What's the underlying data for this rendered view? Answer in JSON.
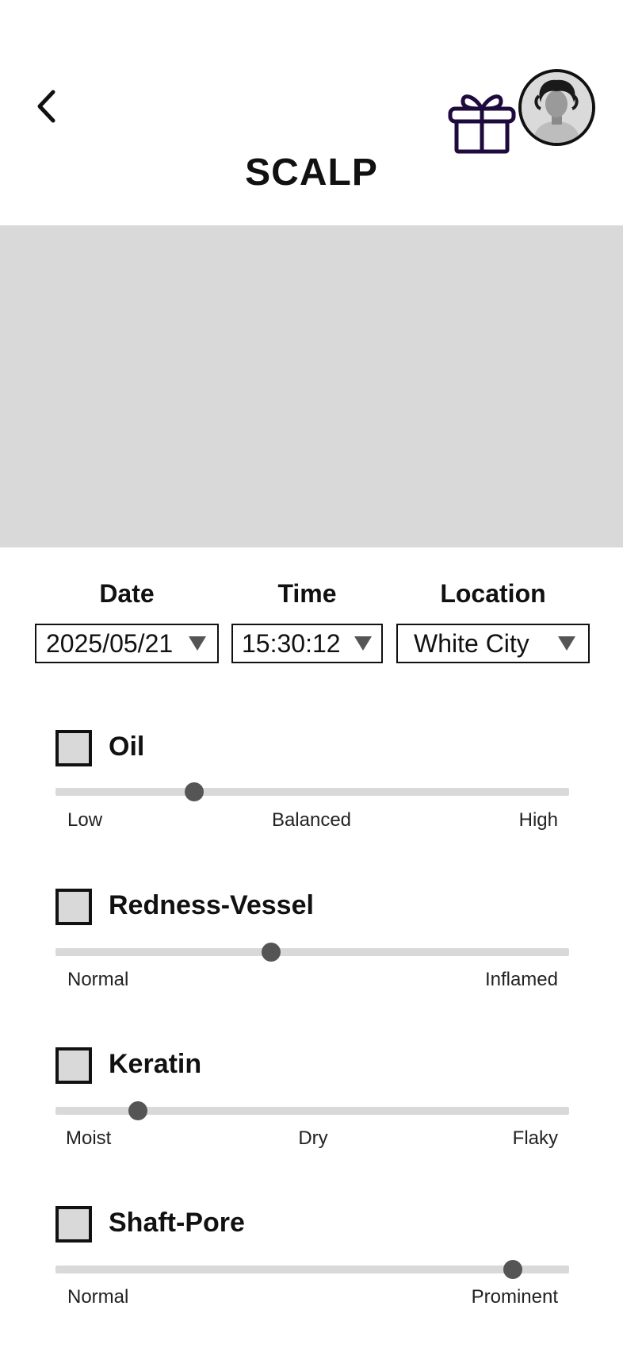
{
  "header": {
    "title": "SCALP",
    "back_icon": "chevron-left-icon",
    "gift_icon": "gift-icon",
    "gift_color": "#1e0a3c"
  },
  "filters": {
    "date": {
      "label": "Date",
      "value": "2025/05/21"
    },
    "time": {
      "label": "Time",
      "value": "15:30:12"
    },
    "location": {
      "label": "Location",
      "value": "White City"
    }
  },
  "sections": [
    {
      "title": "Oil",
      "checked": false,
      "level": 0.27,
      "labels": [
        "Low",
        "Balanced",
        "High"
      ]
    },
    {
      "title": "Redness-Vessel",
      "checked": false,
      "level": 0.42,
      "labels": [
        "Normal",
        "Inflamed"
      ]
    },
    {
      "title": "Keratin",
      "checked": false,
      "level": 0.16,
      "labels": [
        "Moist",
        "Dry",
        "Flaky"
      ]
    },
    {
      "title": "Shaft-Pore",
      "checked": false,
      "level": 0.89,
      "labels": [
        "Normal",
        "Prominent"
      ]
    }
  ],
  "colors": {
    "placeholder": "#d9d9d9",
    "slider_thumb": "#555555"
  }
}
